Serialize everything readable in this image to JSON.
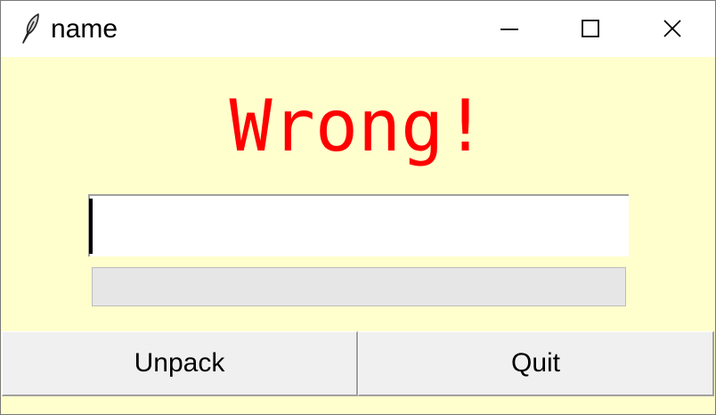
{
  "window": {
    "title": "name",
    "icon": "feather-icon",
    "controls": [
      "minimize-icon",
      "maximize-icon",
      "close-icon"
    ]
  },
  "message": {
    "text": "Wrong!",
    "color": "#ff0000"
  },
  "entry": {
    "value": ""
  },
  "progress": {
    "value": 0
  },
  "buttons": {
    "unpack_label": "Unpack",
    "quit_label": "Quit"
  },
  "colors": {
    "background": "#ffffcd",
    "titlebar": "#ffffff",
    "button_face": "#f0f0f0",
    "progress_trough": "#e6e6e6"
  }
}
